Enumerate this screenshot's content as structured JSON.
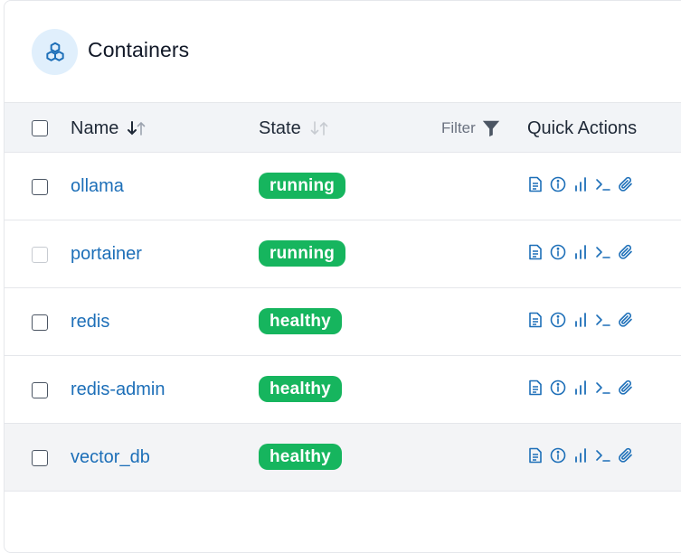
{
  "header": {
    "title": "Containers",
    "icon": "cubes-icon"
  },
  "table": {
    "columns": {
      "name": "Name",
      "state": "State",
      "filter": "Filter",
      "quick_actions": "Quick Actions"
    },
    "rows": [
      {
        "name": "ollama",
        "state": "running",
        "checkbox_disabled": false
      },
      {
        "name": "portainer",
        "state": "running",
        "checkbox_disabled": true
      },
      {
        "name": "redis",
        "state": "healthy",
        "checkbox_disabled": false
      },
      {
        "name": "redis-admin",
        "state": "healthy",
        "checkbox_disabled": false
      },
      {
        "name": "vector_db",
        "state": "healthy",
        "checkbox_disabled": false
      }
    ],
    "quick_action_icons": [
      "logs-icon",
      "inspect-icon",
      "stats-icon",
      "console-icon",
      "attach-icon"
    ]
  },
  "colors": {
    "accent": "#1d6fb8",
    "badge_green": "#16b55e",
    "header_bg": "#f2f4f7",
    "icon_circle_bg": "#e0effc"
  }
}
